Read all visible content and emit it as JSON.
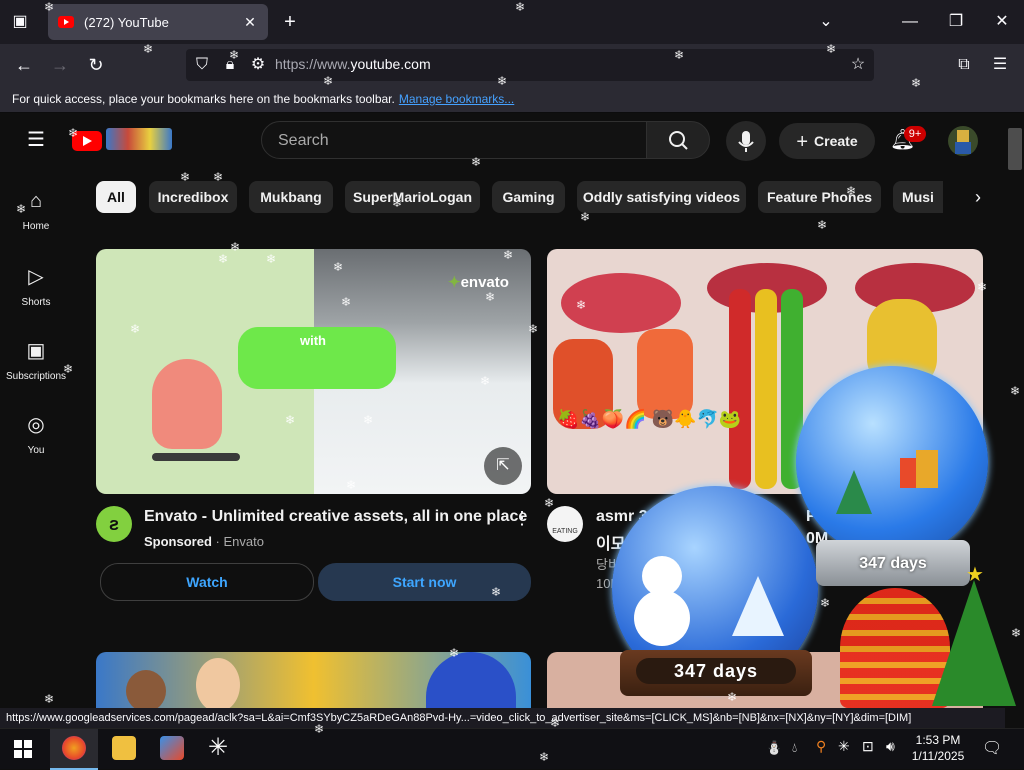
{
  "browser": {
    "tab_title": "(272) YouTube",
    "url_prefix": "https://www.",
    "url_domain": "youtube.com",
    "bookmarks_text": "For quick access, place your bookmarks here on the bookmarks toolbar.",
    "bookmarks_link": "Manage bookmarks...",
    "status_url": "https://www.googleadservices.com/pagead/aclk?sa=L&ai=Cmf3SYbyCZ5aRDeGAn88Pvd-Hy...=video_click_to_advertiser_site&ms=[CLICK_MS]&nb=[NB]&nx=[NX]&ny=[NY]&dim=[DIM]"
  },
  "youtube": {
    "search_placeholder": "Search",
    "create_label": "Create",
    "notification_badge": "9+",
    "chips": [
      "All",
      "Incredibox",
      "Mukbang",
      "SuperMarioLogan",
      "Gaming",
      "Oddly satisfying videos",
      "Feature Phones",
      "Musi"
    ],
    "sidebar": [
      {
        "label": "Home",
        "icon": "home-icon"
      },
      {
        "label": "Shorts",
        "icon": "shorts-icon"
      },
      {
        "label": "Subscriptions",
        "icon": "subscriptions-icon"
      },
      {
        "label": "You",
        "icon": "you-icon"
      }
    ],
    "video1": {
      "title": "Envato - Unlimited creative assets, all in one place",
      "sponsored": "Sponsored",
      "channel": "Envato",
      "brand": "envato",
      "overlay_text": "with",
      "watch_label": "Watch",
      "start_label": "Start now"
    },
    "video2": {
      "title": "asmr 3",
      "title_right": "FOO",
      "line2_left": "이모",
      "line2_right": "0M",
      "line3": "당비",
      "line4": "10M",
      "avatar_text": "EATING"
    }
  },
  "overlay": {
    "globe1_days": "347 days",
    "globe2_days": "347 days"
  },
  "taskbar": {
    "time": "1:53 PM",
    "date": "1/11/2025"
  }
}
